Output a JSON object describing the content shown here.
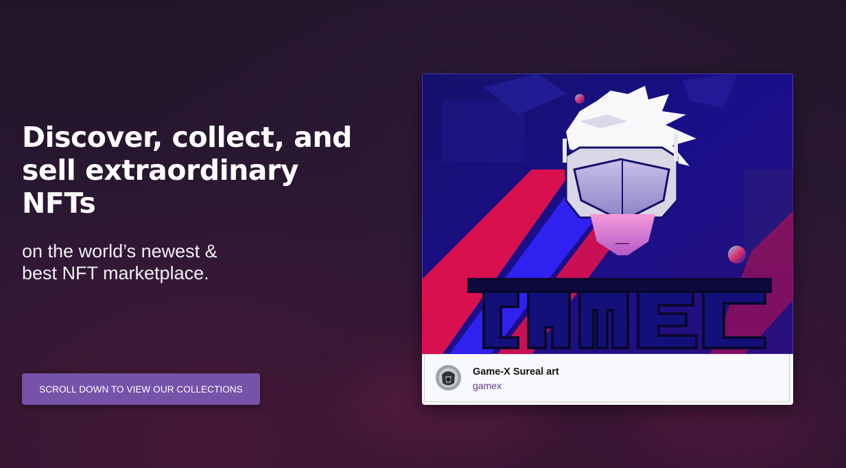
{
  "hero": {
    "headline": "Discover, collect, and sell extraordinary NFTs",
    "subheadline": "on the world’s newest & best NFT marketplace.",
    "cta_label": "SCROLL DOWN TO VIEW OUR COLLECTIONS"
  },
  "featured_card": {
    "title": "Game-X Sureal art",
    "owner": "gamex",
    "image_icon": "anime-gamer-artwork",
    "avatar_icon": "collection-avatar"
  },
  "colors": {
    "background": "#271830",
    "cta_button": "#7652a8",
    "card_background": "#f8f9fc",
    "owner_text": "#5a3b83",
    "artwork_blue": "#1a10c8",
    "artwork_red": "#e8104a"
  }
}
